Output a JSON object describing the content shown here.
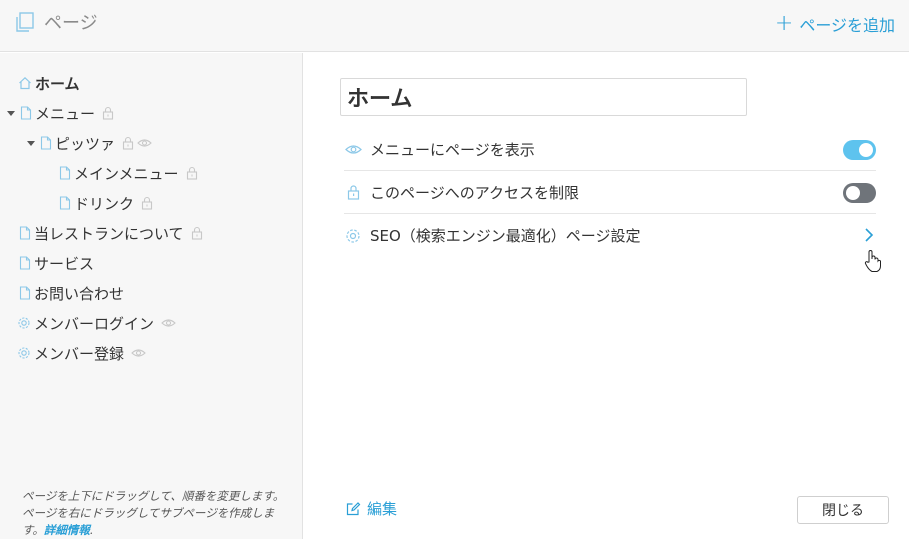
{
  "header": {
    "title": "ページ",
    "add_page_label": "ページを追加",
    "accent_color": "#2a9fd6"
  },
  "sidebar": {
    "items": [
      {
        "label": "ホーム",
        "icon": "home-icon",
        "active": true
      },
      {
        "label": "メニュー",
        "icon": "page-icon",
        "expanded": true,
        "extra": "lock-icon"
      },
      {
        "label": "ピッツァ",
        "icon": "page-icon",
        "expanded": true,
        "extra": [
          "lock-icon",
          "eye-icon"
        ]
      },
      {
        "label": "メインメニュー",
        "icon": "page-icon",
        "extra": "lock-icon"
      },
      {
        "label": "ドリンク",
        "icon": "page-icon",
        "extra": "lock-icon"
      },
      {
        "label": "当レストランについて",
        "icon": "page-icon",
        "extra": "lock-icon"
      },
      {
        "label": "サービス",
        "icon": "page-icon"
      },
      {
        "label": "お問い合わせ",
        "icon": "page-icon"
      },
      {
        "label": "メンバーログイン",
        "icon": "gear-icon",
        "extra": "eye-icon"
      },
      {
        "label": "メンバー登録",
        "icon": "gear-icon",
        "extra": "eye-icon"
      }
    ],
    "hint_line1": "ページを上下にドラッグして、順番を変更します。",
    "hint_line2": "ページを右にドラッグしてサブページを作成します。",
    "hint_link": "詳細情報",
    "hint_tail": "."
  },
  "main": {
    "page_name_value": "ホーム",
    "settings": [
      {
        "label": "メニューにページを表示",
        "icon": "eye-icon",
        "control": "toggle",
        "state": "on"
      },
      {
        "label": "このページへのアクセスを制限",
        "icon": "lock-icon",
        "control": "toggle",
        "state": "off"
      },
      {
        "label": "SEO（検索エンジン最適化）ページ設定",
        "icon": "gear-icon",
        "control": "chevron-right-icon"
      }
    ],
    "edit_label": "編集",
    "close_label": "閉じる"
  },
  "colors": {
    "toggle_on": "#5ec3ee",
    "toggle_off": "#6f747a",
    "icon_blue": "#8cc8e8"
  }
}
